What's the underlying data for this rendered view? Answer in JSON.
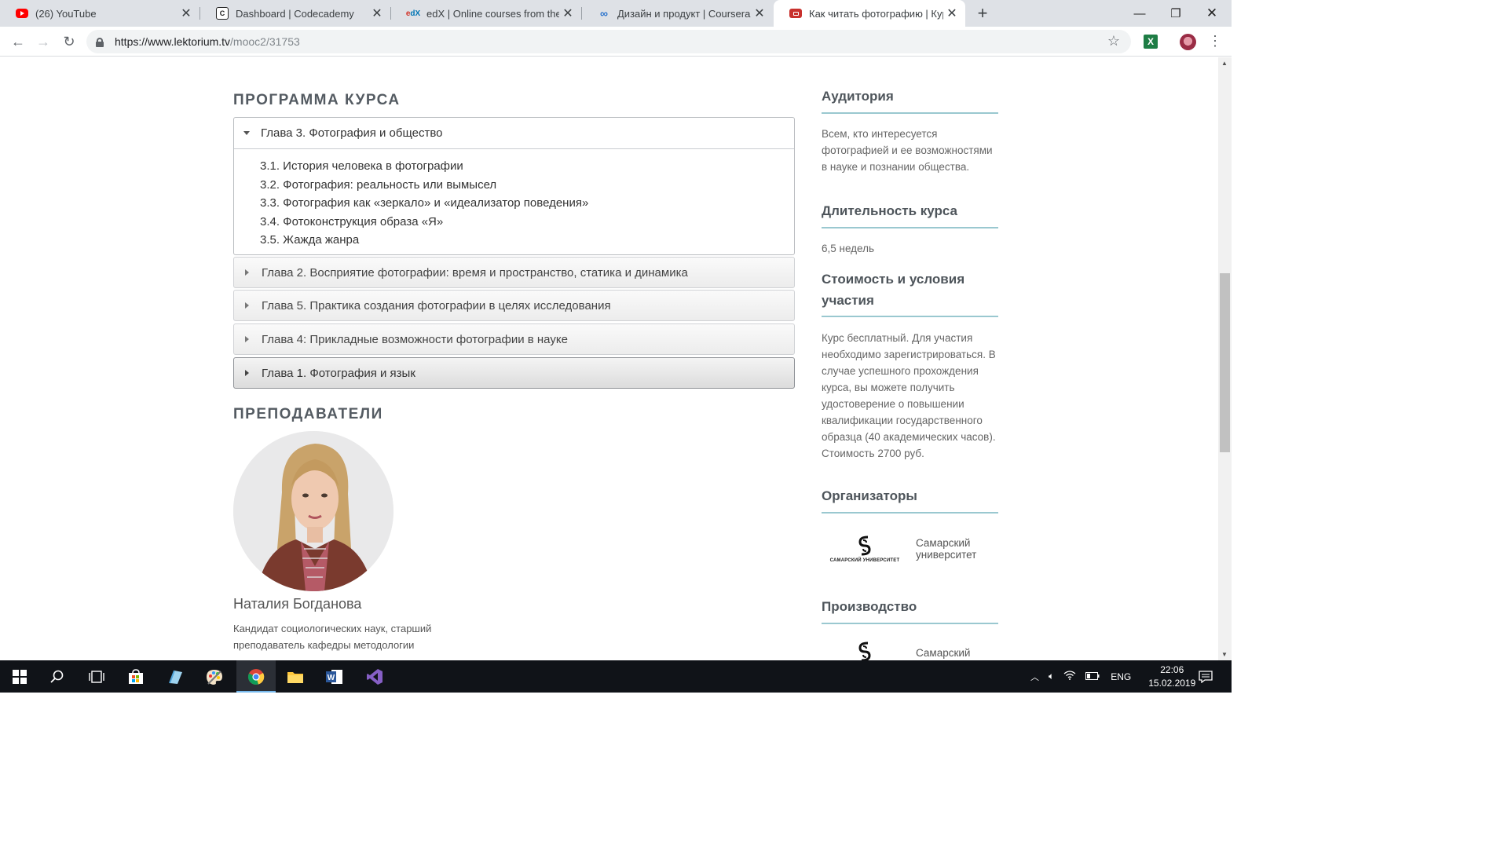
{
  "browser": {
    "tabs": [
      {
        "title": "(26) YouTube",
        "icon": "youtube-icon"
      },
      {
        "title": "Dashboard | Codecademy",
        "icon": "codecademy-icon"
      },
      {
        "title": "edX | Online courses from the wo",
        "icon": "edx-icon"
      },
      {
        "title": "Дизайн и продукт | Coursera",
        "icon": "coursera-icon"
      },
      {
        "title": "Как читать фотографию | Курсы",
        "icon": "lektorium-icon"
      }
    ],
    "url_host": "https://www.lektorium.tv",
    "url_path": "/mooc2/31753"
  },
  "program": {
    "title": "Программа курса",
    "open_chapter": {
      "title": "Глава 3. Фотография и общество",
      "lessons": [
        "3.1. История человека в фотографии",
        "3.2. Фотография: реальность или вымысел",
        "3.3. Фотография как «зеркало» и «идеализатор поведения»",
        "3.4. Фотоконструкция образа «Я»",
        "3.5. Жажда жанра"
      ]
    },
    "chapters": [
      "Глава 2. Восприятие фотографии: время и пространство, статика и динамика",
      "Глава 5. Практика создания фотографии в целях исследования",
      "Глава 4: Прикладные возможности фотографии в науке",
      "Глава 1. Фотография и язык"
    ]
  },
  "teachers": {
    "title": "Преподаватели",
    "name": "Наталия Богданова",
    "desc_line1": "Кандидат социологических наук, старший",
    "desc_line2": "преподаватель кафедры методологии"
  },
  "sidebar": {
    "audience_title": "Аудитория",
    "audience_text": "Всем, кто интересуется фотографией и ее возможностями в науке и познании общества.",
    "duration_title": "Длительность курса",
    "duration_text": "6,5 недель",
    "cost_title": "Стоимость и условия участия",
    "cost_text": "Курс бесплатный. Для участия необходимо зарегистрироваться. В случае успешного прохождения курса, вы можете получить удостоверение о повышении квалификации государственного образца (40 академических часов). Стоимость 2700 руб.",
    "organizers_title": "Организаторы",
    "org_name_line1": "Самарский",
    "org_name_line2": "университет",
    "org_logo_caption": "САМАРСКИЙ УНИВЕРСИТЕТ",
    "production_title": "Производство",
    "prod_name_line1": "Самарский"
  },
  "taskbar": {
    "lang": "ENG",
    "time": "22:06",
    "date": "15.02.2019"
  },
  "colors": {
    "accent_line": "#9ac8d0",
    "heading": "#545b62",
    "taskbar": "#101318"
  }
}
